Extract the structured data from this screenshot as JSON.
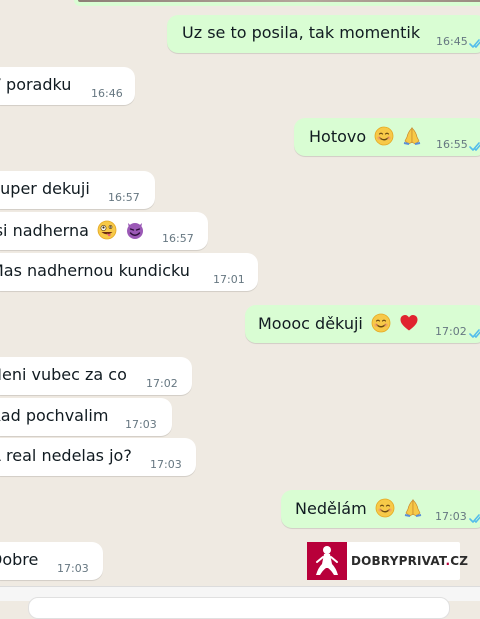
{
  "colors": {
    "chat_background": "#efeae2",
    "incoming_bubble": "#ffffff",
    "outgoing_bubble": "#d9fdd3",
    "timestamp": "#667781",
    "read_ticks": "#53bdeb",
    "watermark_accent": "#b8003a"
  },
  "messages": [
    {
      "direction": "out",
      "text": "Uz se to posila, tak momentik",
      "time": "16:45",
      "status": "read",
      "emoji": []
    },
    {
      "direction": "in",
      "text": "V poradku",
      "time": "16:46",
      "emoji": []
    },
    {
      "direction": "out",
      "text": "Hotovo",
      "time": "16:55",
      "status": "read",
      "emoji": [
        "smiling-face-emoji",
        "folded-hands-emoji"
      ]
    },
    {
      "direction": "in",
      "text": "Super dekuji",
      "time": "16:57",
      "emoji": []
    },
    {
      "direction": "in",
      "text": "Jsi nadherna",
      "time": "16:57",
      "emoji": [
        "zany-face-emoji",
        "smiling-devil-emoji"
      ]
    },
    {
      "direction": "in",
      "text": "Mas nadhernou kundicku",
      "time": "17:01",
      "emoji": []
    },
    {
      "direction": "out",
      "text": "Moooc děkuji",
      "time": "17:02",
      "status": "read",
      "emoji": [
        "smiling-face-emoji",
        "red-heart-emoji"
      ]
    },
    {
      "direction": "in",
      "text": "Neni vubec za co",
      "time": "17:02",
      "emoji": []
    },
    {
      "direction": "in",
      "text": "Rad pochvalim",
      "time": "17:03",
      "emoji": []
    },
    {
      "direction": "in",
      "text": "A real nedelas jo?",
      "time": "17:03",
      "emoji": []
    },
    {
      "direction": "out",
      "text": "Nedělám",
      "time": "17:03",
      "status": "read",
      "emoji": [
        "smiling-face-emoji",
        "folded-hands-emoji"
      ]
    },
    {
      "direction": "in",
      "text": "Dobre",
      "time": "17:03",
      "emoji": []
    }
  ],
  "watermark": {
    "text_main": "DOBRYPRIVAT",
    "text_dot": ".",
    "text_tld": "CZ"
  }
}
